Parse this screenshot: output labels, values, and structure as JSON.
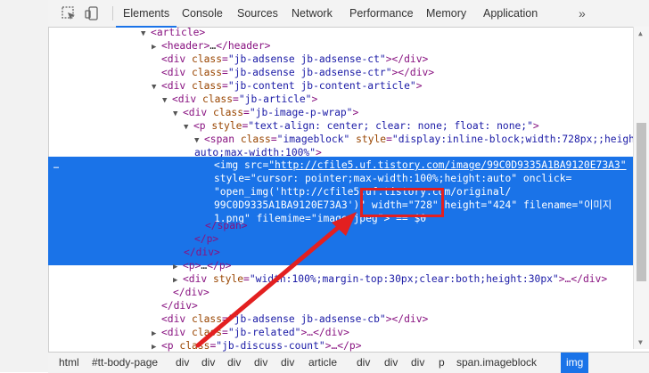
{
  "toolbar": {
    "tabs": [
      "Elements",
      "Console",
      "Sources",
      "Network",
      "Performance",
      "Memory",
      "Application"
    ],
    "active_tab": "Elements",
    "more": "»"
  },
  "tree": {
    "l1": {
      "open": "<",
      "tag": "article",
      "close": ">"
    },
    "l2": {
      "tag": "<header>",
      "mid": "…",
      "end": "</header>"
    },
    "l3": {
      "tag": "<div",
      "attr": "class",
      "val": "\"jb-adsense jb-adsense-ct\"",
      "end": "></div>"
    },
    "l4": {
      "tag": "<div",
      "attr": "class",
      "val": "\"jb-adsense jb-adsense-ctr\"",
      "end": "></div>"
    },
    "l5": {
      "tag": "<div",
      "attr": "class",
      "val": "\"jb-content jb-content-article\"",
      "end": ">"
    },
    "l6": {
      "tag": "<div",
      "attr": "class",
      "val": "\"jb-article\"",
      "end": ">"
    },
    "l7": {
      "tag": "<div",
      "attr": "class",
      "val": "\"jb-image-p-wrap\"",
      "end": ">"
    },
    "l8": {
      "tag": "<p",
      "attr": "style",
      "val": "\"text-align: center; clear: none; float: none;\"",
      "end": ">"
    },
    "l9": {
      "tag": "<span",
      "attr": "class",
      "val": "\"imageblock\"",
      "attr2": "style",
      "val2": "\"display:inline-block;width:728px;;height:"
    },
    "l10": {
      "text": "auto;max-width:100%\"",
      "end": ">"
    },
    "sel": {
      "dots": "…",
      "s1a": "<img",
      "s1b": "src",
      "s1c": "\"http://cfile5.uf.tistory.com/image/99C0D9335A1BA9120E73A3\"",
      "s2a": "style",
      "s2b": "\"cursor: pointer;max-width:100%;height:auto\"",
      "s2c": "onclick=",
      "s3": "\"open_img('http://cfile5.uf.tistory.com/original/",
      "s4a": "99C0D9335A1BA9120E73A3')\"",
      "s4b": "width",
      "s4c": "\"728\"",
      "s4d": "height",
      "s4e": "\"424\"",
      "s4f": "filename",
      "s4g": "\"이미지",
      "s5a": "1.png\"",
      "s5b": "filemime",
      "s5c": "\"image/jpeg\"",
      "s5d": "> == $0"
    },
    "l11": {
      "tag": "</span>"
    },
    "l12": {
      "tag": "</p>"
    },
    "l13": {
      "tag": "</div>"
    },
    "l14": {
      "tag": "<p>",
      "mid": "…",
      "end": "</p>"
    },
    "l15": {
      "tag": "<div",
      "attr": "style",
      "val": "\"width:100%;margin-top:30px;clear:both;height:30px\"",
      "end": ">…</div>"
    },
    "l16": {
      "tag": "</div>"
    },
    "l17": {
      "tag": "</div>"
    },
    "l18": {
      "tag": "<div",
      "attr": "class",
      "val": "\"jb-adsense jb-adsense-cb\"",
      "end": "></div>"
    },
    "l19": {
      "tag": "<div",
      "attr": "class",
      "val": "\"jb-related\"",
      "end": ">…</div>"
    },
    "l20": {
      "tag": "<p",
      "attr": "class",
      "val": "\"jb-discuss-count\"",
      "end": ">…</p>"
    }
  },
  "breadcrumbs": [
    "html",
    "#tt-body-page",
    "div",
    "div",
    "div",
    "div",
    "div",
    "article",
    "div",
    "div",
    "div",
    "p",
    "span.imageblock",
    "img"
  ],
  "colors": {
    "accent": "#1a73e8",
    "tag": "#881280",
    "attr": "#994500",
    "value": "#1a1aa6",
    "annotation": "#e32020"
  }
}
